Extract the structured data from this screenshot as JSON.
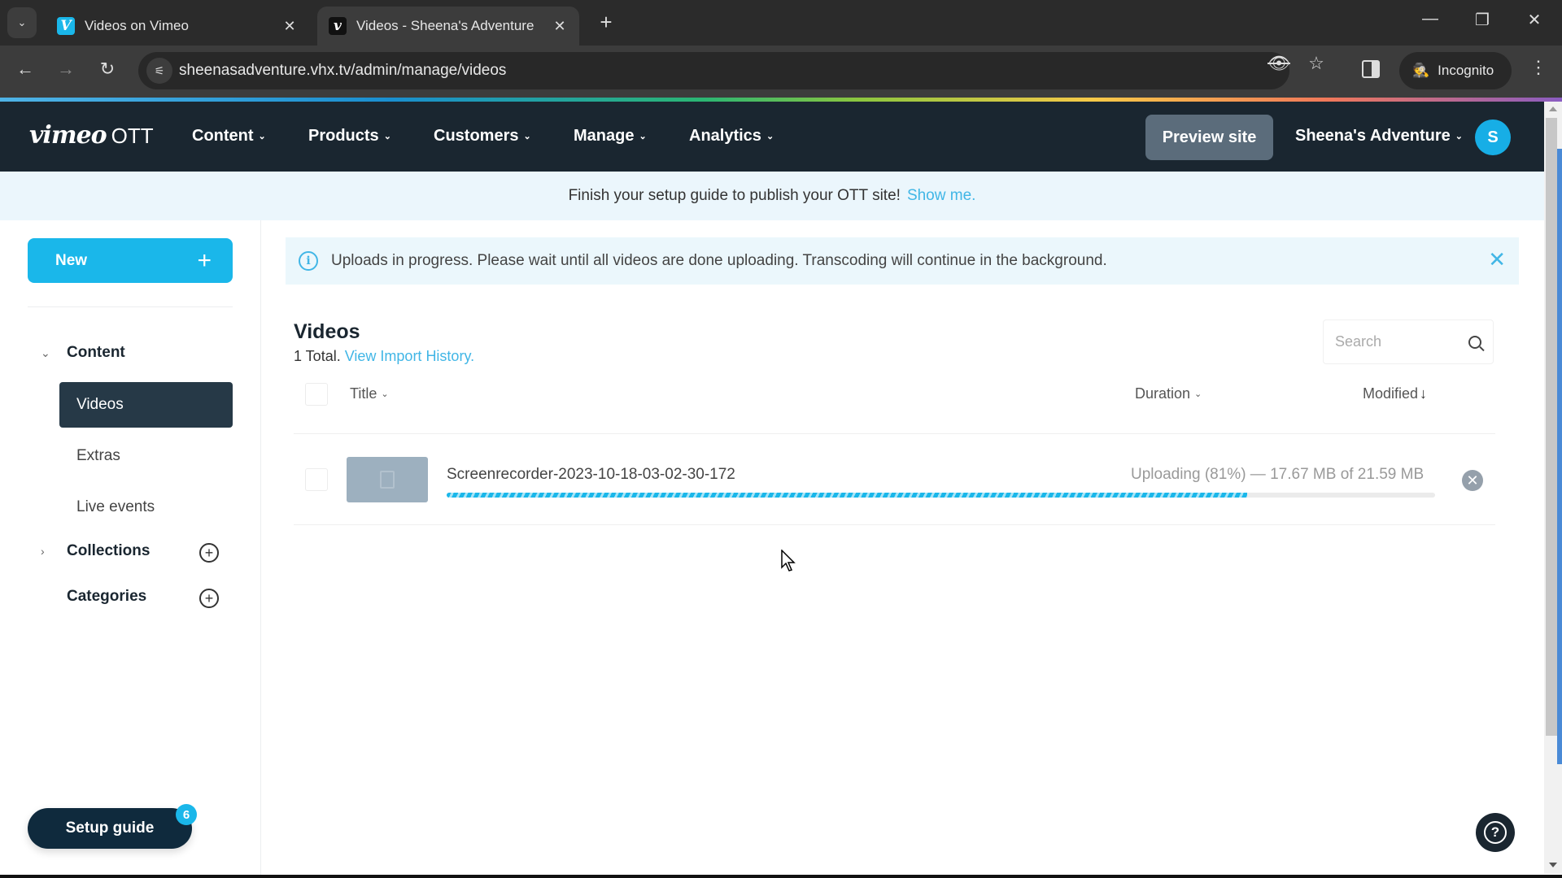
{
  "browser": {
    "tabs": [
      {
        "title": "Videos on Vimeo",
        "favicon": "vimeo-icon",
        "active": false
      },
      {
        "title": "Videos - Sheena's Adventure",
        "favicon": "vhx-v-icon",
        "active": true
      }
    ],
    "tab_close_glyph": "✕",
    "new_tab_glyph": "+",
    "url": "sheenasadventure.vhx.tv/admin/manage/videos",
    "incognito_label": "Incognito",
    "icons": {
      "back": "←",
      "forward": "→",
      "reload": "↻",
      "site_info": "⚟",
      "eye_off": "👁",
      "star": "☆",
      "kebab": "⋮",
      "incognito": "🕵",
      "tab_menu": "⌄",
      "minimize": "—",
      "restore": "❐",
      "close": "✕"
    }
  },
  "header": {
    "logo_main": "vimeo",
    "logo_sub": "OTT",
    "nav": [
      {
        "label": "Content"
      },
      {
        "label": "Products"
      },
      {
        "label": "Customers"
      },
      {
        "label": "Manage"
      },
      {
        "label": "Analytics"
      }
    ],
    "chevron": "⌄",
    "preview_label": "Preview site",
    "account_label": "Sheena's Adventure",
    "avatar_initial": "S"
  },
  "setup_banner": {
    "text": "Finish your setup guide to publish your OTT site!",
    "link": "Show me."
  },
  "sidebar": {
    "new_label": "New",
    "new_icon": "+",
    "groups": [
      {
        "label": "Content",
        "caret": "⌄",
        "expanded": true
      },
      {
        "label": "Collections",
        "caret": "›",
        "expanded": false,
        "add_icon": "+"
      },
      {
        "label": "Categories",
        "add_icon": "+"
      }
    ],
    "items": [
      {
        "label": "Videos",
        "active": true
      },
      {
        "label": "Extras",
        "active": false
      },
      {
        "label": "Live events",
        "active": false
      }
    ],
    "setup_guide_label": "Setup guide",
    "setup_guide_badge": "6"
  },
  "alert": {
    "icon": "i",
    "text": "Uploads in progress. Please wait until all videos are done uploading. Transcoding will continue in the background.",
    "close_glyph": "✕"
  },
  "main": {
    "title": "Videos",
    "total_text": "1 Total.",
    "import_link": "View Import History.",
    "search_placeholder": "Search",
    "columns": {
      "title": "Title",
      "duration": "Duration",
      "modified": "Modified",
      "chevron": "⌄",
      "sort_arrow": "↓"
    },
    "rows": [
      {
        "title": "Screenrecorder-2023-10-18-03-02-30-172",
        "status": "Uploading (81%) — 17.67 MB of 21.59 MB",
        "progress": 0.81,
        "cancel_glyph": "✕"
      }
    ]
  },
  "help_glyph": "?",
  "colors": {
    "accent": "#1ab7ea",
    "nav_bg": "#1a2630",
    "sidebar_active": "#263947",
    "banner_bg": "#ebf6fc",
    "link": "#41b6e6"
  }
}
